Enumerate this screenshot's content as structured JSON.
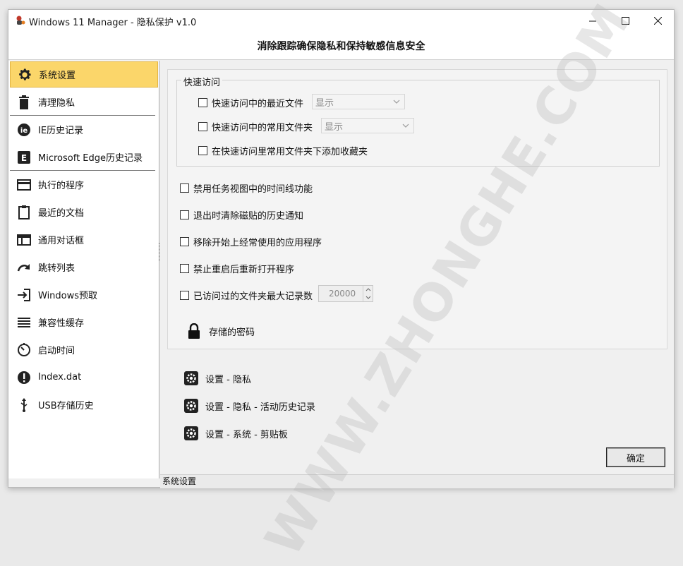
{
  "window": {
    "title": "Windows 11 Manager - 隐私保护 v1.0",
    "header": "消除跟踪确保隐私和保持敏感信息安全"
  },
  "sidebar": {
    "items": [
      {
        "label": "系统设置",
        "icon": "gear-icon",
        "active": true
      },
      {
        "label": "清理隐私",
        "icon": "trash-icon"
      },
      {
        "label": "IE历史记录",
        "icon": "ie-icon"
      },
      {
        "label": "Microsoft  Edge历史记录",
        "icon": "edge-icon"
      },
      {
        "label": "执行的程序",
        "icon": "window-card-icon"
      },
      {
        "label": "最近的文档",
        "icon": "clipboard-icon"
      },
      {
        "label": "通用对话框",
        "icon": "dialog-icon"
      },
      {
        "label": "跳转列表",
        "icon": "redo-arrow-icon"
      },
      {
        "label": "Windows预取",
        "icon": "sign-in-icon"
      },
      {
        "label": "兼容性缓存",
        "icon": "list-lines-icon"
      },
      {
        "label": "启动时间",
        "icon": "timer-icon"
      },
      {
        "label": "Index.dat",
        "icon": "exclamation-icon"
      },
      {
        "label": "USB存储历史",
        "icon": "usb-icon"
      }
    ]
  },
  "quick_access": {
    "legend": "快速访问",
    "recent_files": {
      "label": "快速访问中的最近文件",
      "select": "显示"
    },
    "frequent_folders": {
      "label": "快速访问中的常用文件夹",
      "select": "显示"
    },
    "add_favorites": {
      "label": "在快速访问里常用文件夹下添加收藏夹"
    }
  },
  "options": {
    "timeline": "禁用任务视图中的时间线功能",
    "clear_tile_notify": "退出时清除磁贴的历史通知",
    "remove_frequent_apps": "移除开始上经常使用的应用程序",
    "no_reopen": "禁止重启后重新打开程序",
    "max_folders": {
      "label": "已访问过的文件夹最大记录数",
      "value": "20000"
    }
  },
  "stored_passwords": "存储的密码",
  "links": [
    "设置 - 隐私",
    "设置 - 隐私 - 活动历史记录",
    "设置 - 系统 - 剪贴板"
  ],
  "ok_button": "确定",
  "status_text": "系统设置",
  "watermark": "WWW.ZHONGHE.COM",
  "colors": {
    "active_item": "#fbd66a",
    "accent_border": "#e2b443"
  }
}
